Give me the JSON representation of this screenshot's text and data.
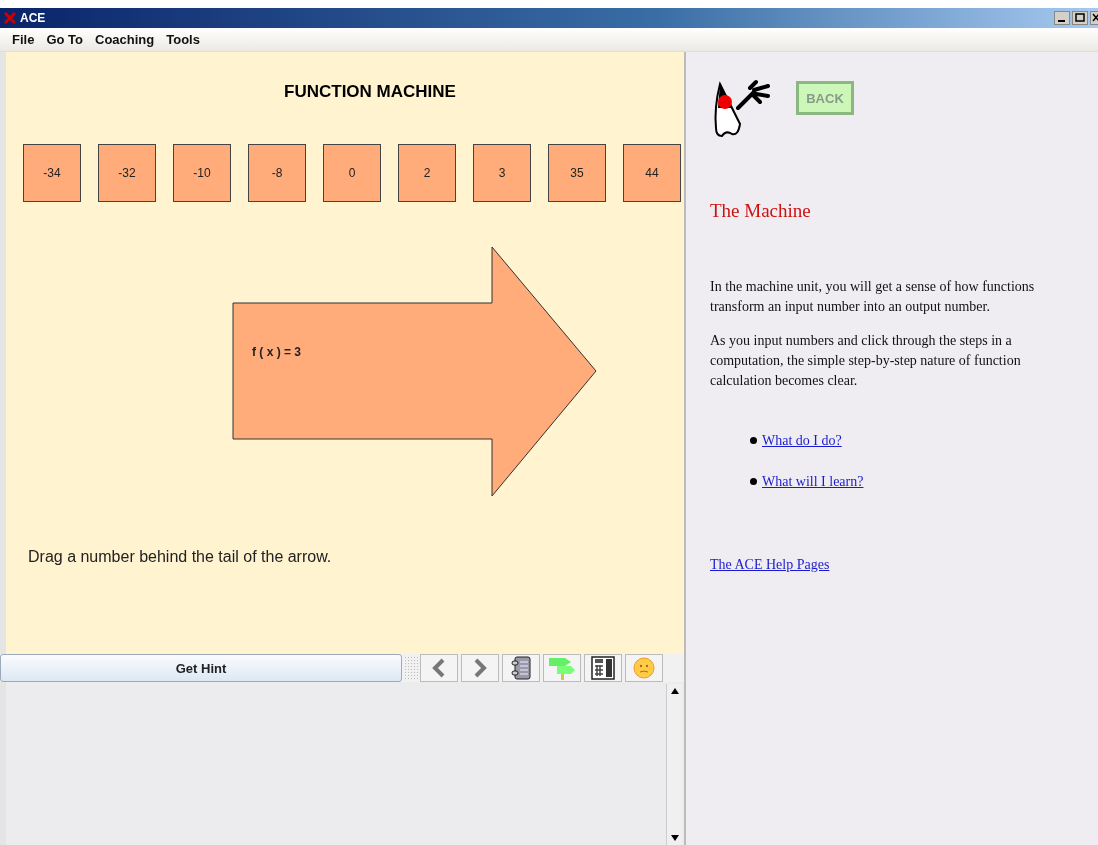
{
  "window": {
    "title": "ACE"
  },
  "menu": [
    "File",
    "Go To",
    "Coaching",
    "Tools"
  ],
  "machine": {
    "title": "FUNCTION MACHINE",
    "numbers": [
      "-34",
      "-32",
      "-10",
      "-8",
      "0",
      "2",
      "3",
      "35",
      "44"
    ],
    "function_label": "f ( x ) = 3",
    "instruction": "Drag a number behind the tail of the arrow."
  },
  "hint_bar": {
    "button": "Get Hint"
  },
  "help": {
    "back_button": "BACK",
    "heading": "The Machine",
    "paragraphs": [
      "In the machine unit, you will get a sense of how functions transform an input number into an output number.",
      "As you input numbers and click through the steps in a computation, the simple step-by-step nature of function calculation becomes clear."
    ],
    "links": [
      "What do I do?",
      "What will I learn?"
    ],
    "footer_link": "The ACE Help Pages"
  }
}
